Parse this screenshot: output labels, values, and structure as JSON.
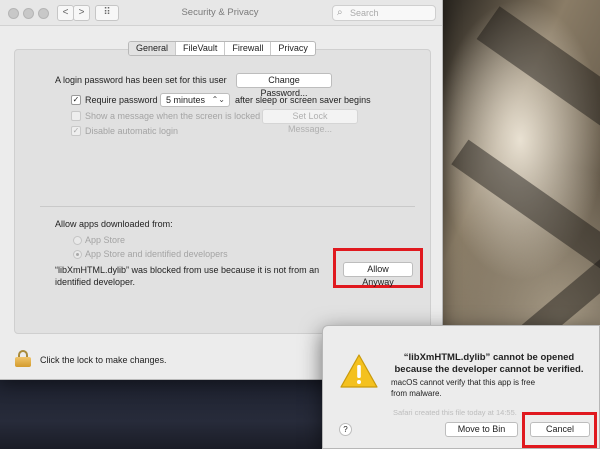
{
  "window": {
    "title": "Security & Privacy",
    "search_placeholder": "Search",
    "back_glyph": "<",
    "forward_glyph": ">",
    "grid_glyph": "⠿"
  },
  "tabs": [
    {
      "label": "General",
      "active": true
    },
    {
      "label": "FileVault",
      "active": false
    },
    {
      "label": "Firewall",
      "active": false
    },
    {
      "label": "Privacy",
      "active": false
    }
  ],
  "general": {
    "login_text": "A login password has been set for this user",
    "change_password_label": "Change Password...",
    "require_password_label": "Require password",
    "require_password_checked": true,
    "require_password_delay": "5 minutes",
    "after_sleep_text": "after sleep or screen saver begins",
    "show_message_label": "Show a message when the screen is locked",
    "set_lock_message_label": "Set Lock Message...",
    "disable_autologin_label": "Disable automatic login"
  },
  "downloads": {
    "heading": "Allow apps downloaded from:",
    "options": [
      {
        "label": "App Store",
        "selected": false
      },
      {
        "label": "App Store and identified developers",
        "selected": true
      }
    ],
    "blocked_line1": "“libXmHTML.dylib” was blocked from use because it is not from an",
    "blocked_line2": "identified developer.",
    "allow_anyway_label": "Allow Anyway"
  },
  "lock": {
    "text": "Click the lock to make changes."
  },
  "dialog": {
    "title_line1": "“libXmHTML.dylib” cannot be opened",
    "title_line2": "because the developer cannot be verified.",
    "body_line1": "macOS cannot verify that this app is free",
    "body_line2": "from malware.",
    "note": "Safari created this file today at 14:55.",
    "help_label": "?",
    "move_to_bin_label": "Move to Bin",
    "cancel_label": "Cancel"
  },
  "colors": {
    "highlight": "#e0191f",
    "lock": "#e5ac3e",
    "warning": "#f4c11f"
  }
}
